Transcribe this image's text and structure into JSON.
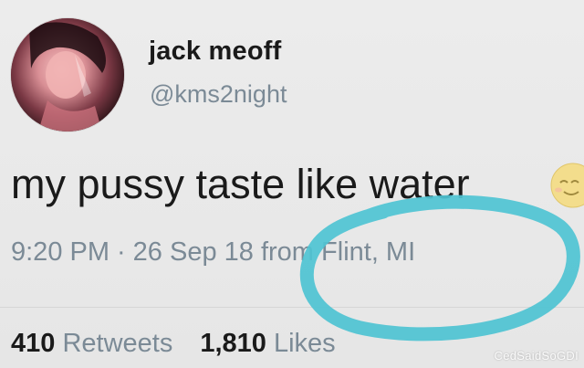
{
  "user": {
    "display_name": "jack meoff",
    "handle": "@kms2night"
  },
  "tweet": {
    "text": "my pussy taste like water",
    "emoji_icon": "smiling-emoji-icon"
  },
  "meta": {
    "time": "9:20 PM",
    "separator": "·",
    "date": "26 Sep 18",
    "location_prefix": "from",
    "location": "Flint, MI"
  },
  "stats": {
    "retweets_count": "410",
    "retweets_label": "Retweets",
    "likes_count": "1,810",
    "likes_label": "Likes"
  },
  "annotation": {
    "color": "#4ec3d2"
  },
  "watermark": "CedSaidSoGDI"
}
